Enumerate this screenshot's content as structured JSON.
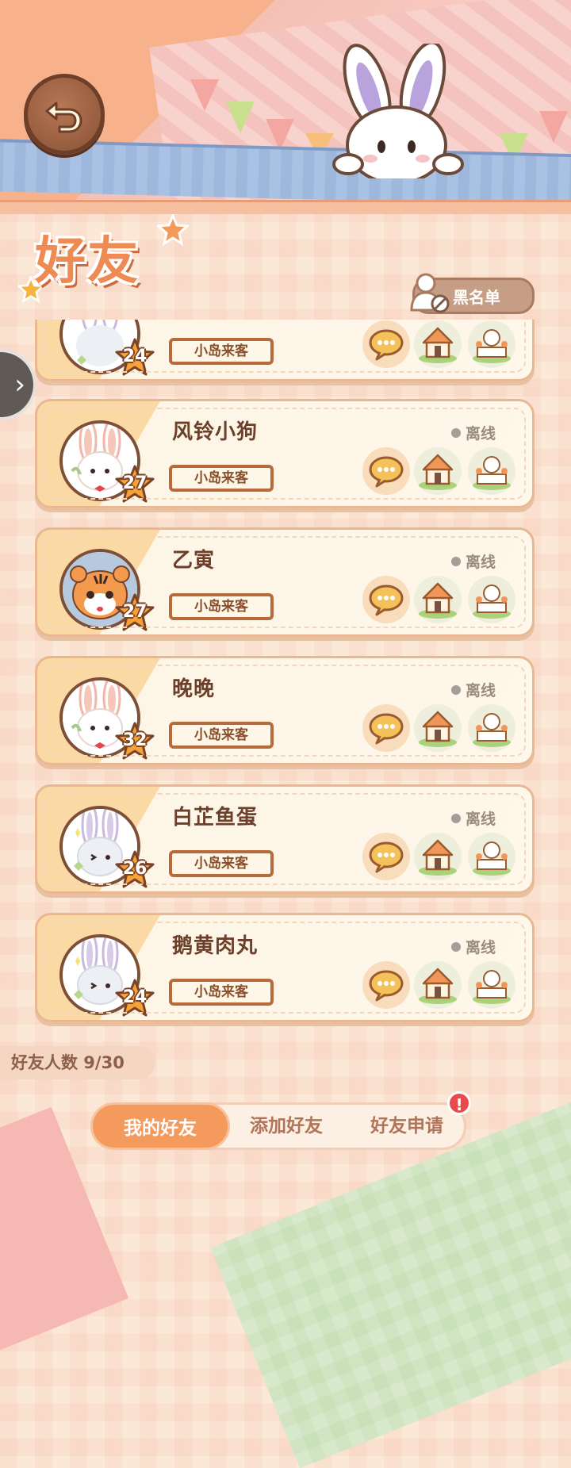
{
  "header": {
    "title": "好友",
    "blacklist_label": "黑名单"
  },
  "friends": [
    {
      "name": "",
      "level": "24",
      "tag": "小岛来客",
      "status": "",
      "avatar": "white-bunny-lilac"
    },
    {
      "name": "风铃小狗",
      "level": "27",
      "tag": "小岛来客",
      "status": "离线",
      "avatar": "white-bunny-pink"
    },
    {
      "name": "乙寅",
      "level": "27",
      "tag": "小岛来客",
      "status": "离线",
      "avatar": "tiger-cub"
    },
    {
      "name": "晚晚",
      "level": "32",
      "tag": "小岛来客",
      "status": "离线",
      "avatar": "white-bunny-pink"
    },
    {
      "name": "白芷鱼蛋",
      "level": "26",
      "tag": "小岛来客",
      "status": "离线",
      "avatar": "white-bunny-lilac"
    },
    {
      "name": "鹅黄肉丸",
      "level": "24",
      "tag": "小岛来客",
      "status": "离线",
      "avatar": "white-bunny-lilac"
    }
  ],
  "footer": {
    "friend_count_label": "好友人数 9/30"
  },
  "tabs": {
    "my_friends": "我的好友",
    "add_friends": "添加好友",
    "requests": "好友申请",
    "requests_alert": "!"
  },
  "colors": {
    "accent": "#f49a5c",
    "brown": "#6b3f2a",
    "alert": "#e84b4b"
  }
}
